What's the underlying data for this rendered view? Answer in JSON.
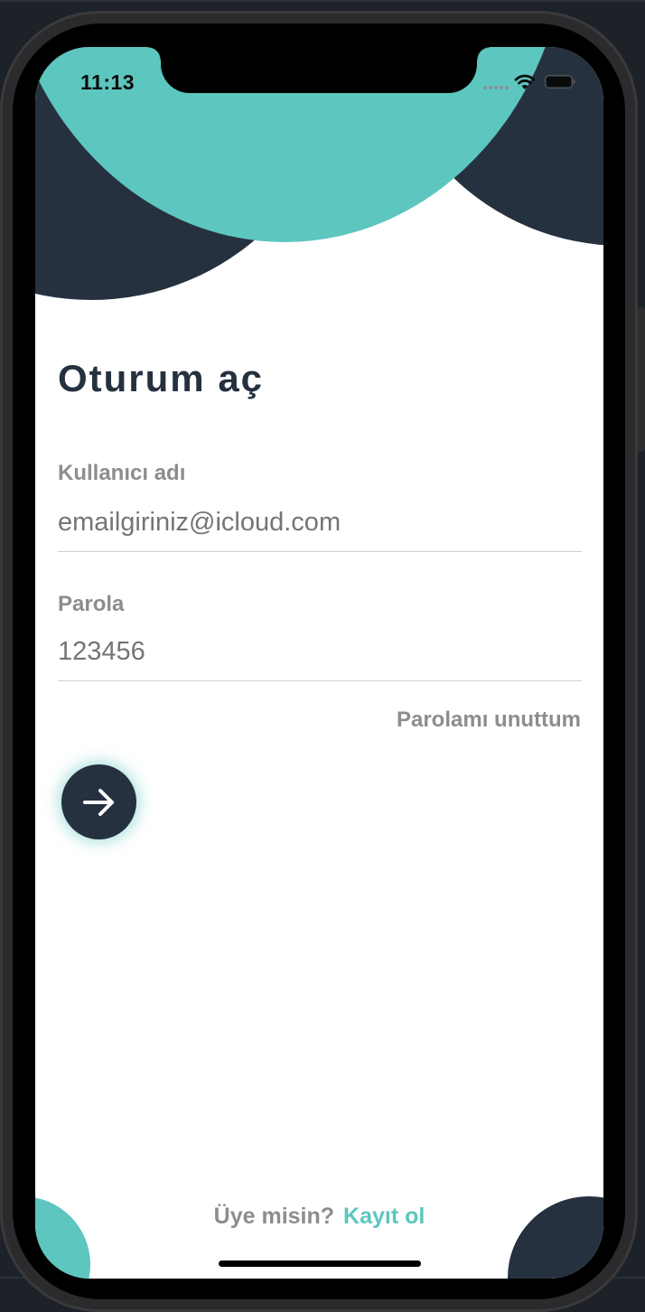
{
  "status_bar": {
    "time": "11:13"
  },
  "login": {
    "title": "Oturum aç",
    "username_label": "Kullanıcı adı",
    "username_placeholder": "emailgiriniz@icloud.com",
    "password_label": "Parola",
    "password_placeholder": "123456",
    "forgot_password": "Parolamı unuttum"
  },
  "footer": {
    "question": "Üye misin?",
    "register": "Kayıt ol"
  },
  "colors": {
    "accent_teal": "#5cc6bf",
    "dark_navy": "#263140",
    "label_gray": "#8d8d8f"
  }
}
